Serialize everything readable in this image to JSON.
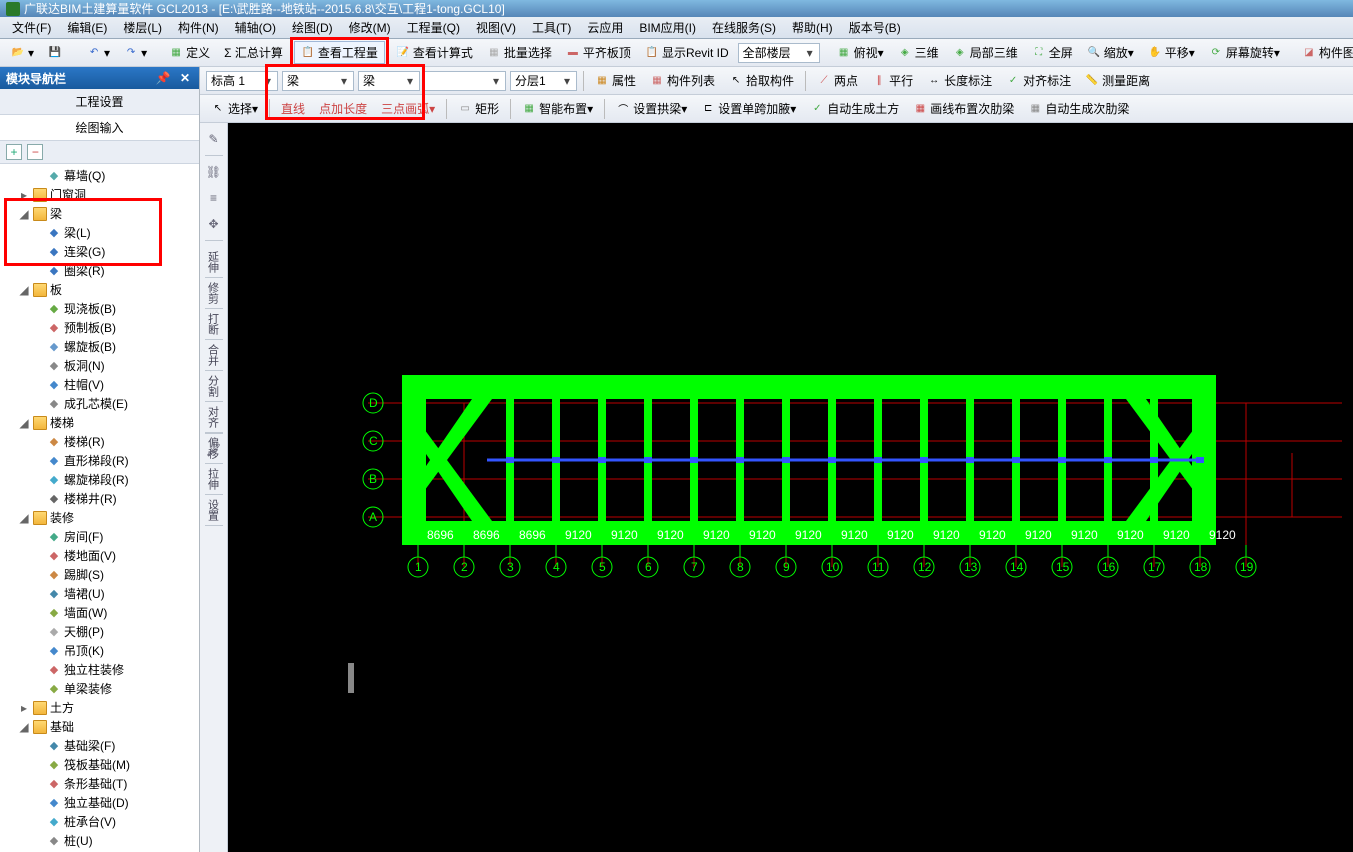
{
  "title": "广联达BIM土建算量软件 GCL2013 - [E:\\武胜路--地铁站--2015.6.8\\交互\\工程1-tong.GCL10]",
  "menu": [
    "文件(F)",
    "编辑(E)",
    "楼层(L)",
    "构件(N)",
    "辅轴(O)",
    "绘图(D)",
    "修改(M)",
    "工程量(Q)",
    "视图(V)",
    "工具(T)",
    "云应用",
    "BIM应用(I)",
    "在线服务(S)",
    "帮助(H)",
    "版本号(B)"
  ],
  "tb1": {
    "define": "定义",
    "sum": "Σ 汇总计算",
    "view_qty": "查看工程量",
    "view_formula": "查看计算式",
    "batch_sel": "批量选择",
    "align_top": "平齐板顶",
    "show_revit": "显示Revit ID",
    "floor_sel": "全部楼层",
    "ortho": "俯视",
    "three_d": "三维",
    "local_3d": "局部三维",
    "fullscreen": "全屏",
    "zoom": "缩放",
    "pan": "平移",
    "screen_rot": "屏幕旋转",
    "component_show": "构件图元显..."
  },
  "tb2": {
    "d1": "标高 1",
    "d2": "梁",
    "d3": "梁",
    "d4": "",
    "d5": "分层1",
    "attr": "属性",
    "comp_list": "构件列表",
    "pick_comp": "拾取构件",
    "two_pt": "两点",
    "parallel": "平行",
    "len_dim": "长度标注",
    "align_dim": "对齐标注",
    "measure": "测量距离"
  },
  "tb3": {
    "select": "选择",
    "line": "直线",
    "pt_len": "点加长度",
    "arc3": "三点画弧",
    "rect": "矩形",
    "smart_arrange": "智能布置",
    "set_arch": "设置拱梁",
    "set_span": "设置单跨加腋",
    "auto_earth": "自动生成土方",
    "draw_rib": "画线布置次肋梁",
    "auto_rib": "自动生成次肋梁"
  },
  "nav": {
    "header": "模块导航栏",
    "sub1": "工程设置",
    "sub2": "绘图输入",
    "items": [
      {
        "t": "幕墙(Q)",
        "lvl": 2,
        "leaf": true,
        "ic": "#5aa"
      },
      {
        "t": "门窗洞",
        "lvl": 1,
        "folder": true,
        "tw": "▸"
      },
      {
        "t": "梁",
        "lvl": 1,
        "folder": true,
        "tw": "◢",
        "hl": true
      },
      {
        "t": "梁(L)",
        "lvl": 2,
        "leaf": true,
        "ic": "#3a76c0",
        "hl": true
      },
      {
        "t": "连梁(G)",
        "lvl": 2,
        "leaf": true,
        "ic": "#3a76c0",
        "hl": true
      },
      {
        "t": "圈梁(R)",
        "lvl": 2,
        "leaf": true,
        "ic": "#3a76c0",
        "hl": true
      },
      {
        "t": "板",
        "lvl": 1,
        "folder": true,
        "tw": "◢"
      },
      {
        "t": "现浇板(B)",
        "lvl": 2,
        "leaf": true,
        "ic": "#6a4"
      },
      {
        "t": "预制板(B)",
        "lvl": 2,
        "leaf": true,
        "ic": "#c66"
      },
      {
        "t": "螺旋板(B)",
        "lvl": 2,
        "leaf": true,
        "ic": "#69c"
      },
      {
        "t": "板洞(N)",
        "lvl": 2,
        "leaf": true,
        "ic": "#888"
      },
      {
        "t": "柱帽(V)",
        "lvl": 2,
        "leaf": true,
        "ic": "#48c"
      },
      {
        "t": "成孔芯模(E)",
        "lvl": 2,
        "leaf": true,
        "ic": "#888"
      },
      {
        "t": "楼梯",
        "lvl": 1,
        "folder": true,
        "tw": "◢"
      },
      {
        "t": "楼梯(R)",
        "lvl": 2,
        "leaf": true,
        "ic": "#c84"
      },
      {
        "t": "直形梯段(R)",
        "lvl": 2,
        "leaf": true,
        "ic": "#48c"
      },
      {
        "t": "螺旋梯段(R)",
        "lvl": 2,
        "leaf": true,
        "ic": "#4ac"
      },
      {
        "t": "楼梯井(R)",
        "lvl": 2,
        "leaf": true,
        "ic": "#666"
      },
      {
        "t": "装修",
        "lvl": 1,
        "folder": true,
        "tw": "◢"
      },
      {
        "t": "房间(F)",
        "lvl": 2,
        "leaf": true,
        "ic": "#4a8"
      },
      {
        "t": "楼地面(V)",
        "lvl": 2,
        "leaf": true,
        "ic": "#c66"
      },
      {
        "t": "踢脚(S)",
        "lvl": 2,
        "leaf": true,
        "ic": "#c84"
      },
      {
        "t": "墙裙(U)",
        "lvl": 2,
        "leaf": true,
        "ic": "#48a"
      },
      {
        "t": "墙面(W)",
        "lvl": 2,
        "leaf": true,
        "ic": "#8a4"
      },
      {
        "t": "天棚(P)",
        "lvl": 2,
        "leaf": true,
        "ic": "#aaa"
      },
      {
        "t": "吊顶(K)",
        "lvl": 2,
        "leaf": true,
        "ic": "#48c"
      },
      {
        "t": "独立柱装修",
        "lvl": 2,
        "leaf": true,
        "ic": "#c66"
      },
      {
        "t": "单梁装修",
        "lvl": 2,
        "leaf": true,
        "ic": "#8a4"
      },
      {
        "t": "土方",
        "lvl": 1,
        "folder": true,
        "tw": "▸"
      },
      {
        "t": "基础",
        "lvl": 1,
        "folder": true,
        "tw": "◢"
      },
      {
        "t": "基础梁(F)",
        "lvl": 2,
        "leaf": true,
        "ic": "#48a"
      },
      {
        "t": "筏板基础(M)",
        "lvl": 2,
        "leaf": true,
        "ic": "#8a4"
      },
      {
        "t": "条形基础(T)",
        "lvl": 2,
        "leaf": true,
        "ic": "#c66"
      },
      {
        "t": "独立基础(D)",
        "lvl": 2,
        "leaf": true,
        "ic": "#48c"
      },
      {
        "t": "桩承台(V)",
        "lvl": 2,
        "leaf": true,
        "ic": "#4ac"
      },
      {
        "t": "桩(U)",
        "lvl": 2,
        "leaf": true,
        "ic": "#888"
      }
    ]
  },
  "side_tools_v": [
    "延伸",
    "修剪",
    "打断",
    "合并",
    "分割",
    "对齐",
    "偏移",
    "拉伸",
    "设置"
  ],
  "axes_v": [
    "D",
    "C",
    "B",
    "A"
  ],
  "axes_h": [
    "1",
    "2",
    "3",
    "4",
    "5",
    "6",
    "7",
    "8",
    "9",
    "10",
    "11",
    "12",
    "13",
    "14",
    "15",
    "16",
    "17",
    "18",
    "19"
  ],
  "dims": [
    "8696",
    "8696",
    "8696",
    "9120",
    "9120",
    "9120",
    "9120",
    "9120",
    "9120",
    "9120",
    "9120",
    "9120",
    "9120",
    "9120",
    "9120",
    "9120",
    "9120",
    "9120"
  ]
}
